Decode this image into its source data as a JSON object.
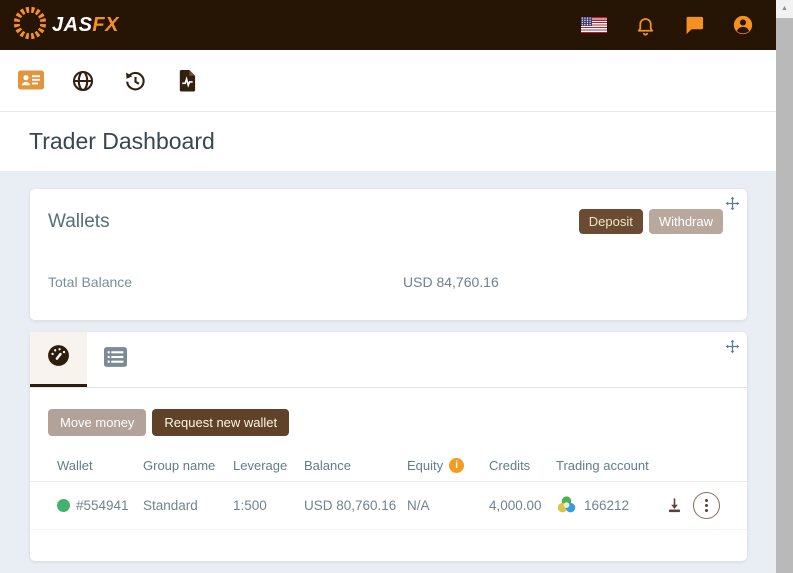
{
  "topbar": {
    "logo_jas": "JAS",
    "logo_fx": "FX"
  },
  "page_title": "Trader Dashboard",
  "wallets_card": {
    "title": "Wallets",
    "deposit_button": "Deposit",
    "withdraw_button": "Withdraw",
    "total_balance_label": "Total Balance",
    "total_balance_value": "USD 84,760.16"
  },
  "accounts_card": {
    "move_money_button": "Move money",
    "request_new_wallet_button": "Request new wallet",
    "table": {
      "headers": {
        "wallet": "Wallet",
        "group_name": "Group name",
        "leverage": "Leverage",
        "balance": "Balance",
        "equity": "Equity",
        "credits": "Credits",
        "trading_account": "Trading account"
      },
      "rows": [
        {
          "wallet": "#554941",
          "group_name": "Standard",
          "leverage": "1:500",
          "balance": "USD 80,760.16",
          "equity": "N/A",
          "credits": "4,000.00",
          "trading_account": "166212"
        }
      ]
    }
  },
  "icon_glyphs": {
    "scroll_up": "▲",
    "info": "i"
  },
  "colors": {
    "accent_orange": "#F59120",
    "topbar_brown": "#261405",
    "button_dark_brown": "#6A4B33",
    "button_tan": "#B9A89D",
    "status_green": "#43B06E",
    "text_gray": "#72838E"
  }
}
